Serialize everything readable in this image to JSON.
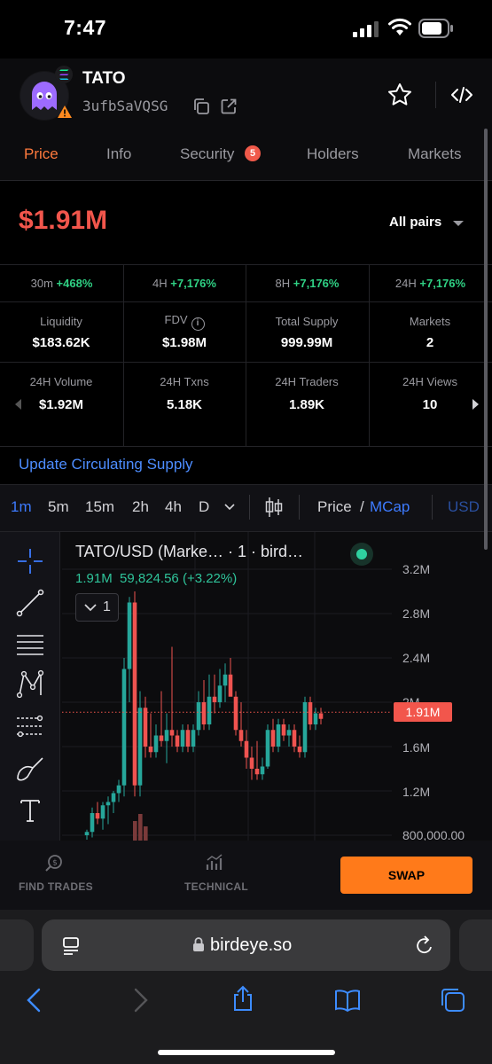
{
  "status_bar": {
    "time": "7:47"
  },
  "token": {
    "name": "TATO",
    "address": "3ufbSaVQSG"
  },
  "tabs": [
    {
      "label": "Price",
      "active": true
    },
    {
      "label": "Info",
      "active": false
    },
    {
      "label": "Security",
      "active": false,
      "badge": "5"
    },
    {
      "label": "Holders",
      "active": false
    },
    {
      "label": "Markets",
      "active": false
    }
  ],
  "price": {
    "market_cap": "$1.91M",
    "pair_selector": "All pairs"
  },
  "changes": [
    {
      "period": "30m",
      "value": "+468%"
    },
    {
      "period": "4H",
      "value": "+7,176%"
    },
    {
      "period": "8H",
      "value": "+7,176%"
    },
    {
      "period": "24H",
      "value": "+7,176%"
    }
  ],
  "stats_row1": [
    {
      "label": "Liquidity",
      "value": "$183.62K"
    },
    {
      "label": "FDV",
      "value": "$1.98M",
      "info": "i"
    },
    {
      "label": "Total Supply",
      "value": "999.99M"
    },
    {
      "label": "Markets",
      "value": "2"
    }
  ],
  "stats_row2": [
    {
      "label": "24H Volume",
      "value": "$1.92M"
    },
    {
      "label": "24H Txns",
      "value": "5.18K"
    },
    {
      "label": "24H Traders",
      "value": "1.89K"
    },
    {
      "label": "24H Views",
      "value": "10"
    }
  ],
  "update_link": "Update Circulating Supply",
  "intervals": [
    "1m",
    "5m",
    "15m",
    "2h",
    "4h",
    "D"
  ],
  "active_interval": "1m",
  "view_toggle": {
    "price": "Price",
    "separator": "/",
    "mcap": "MCap",
    "currency": "USD"
  },
  "chart": {
    "title": "TATO/USD (Marke…  · 1 · bird…",
    "ohlc_last": "1.91M",
    "ohlc_change": "59,824.56 (+3.22%)",
    "collapse_label": "1",
    "last_price_label": "1.91M",
    "y_ticks": [
      "3.2M",
      "2.8M",
      "2.4M",
      "2M",
      "1.6M",
      "1.2M",
      "800,000.00"
    ],
    "colors": {
      "up": "#26a69a",
      "down": "#ef5350",
      "bg": "#0c0c0e"
    }
  },
  "chart_data": {
    "type": "candlestick",
    "title": "TATO/USD (Marke…  · 1 · bird…",
    "ylim": [
      800000,
      3400000
    ],
    "y_ticks": [
      3200000,
      2800000,
      2400000,
      2000000,
      1600000,
      1200000,
      800000
    ],
    "last_value": 1910000,
    "candles": [
      {
        "o": 800000,
        "h": 850000,
        "l": 760000,
        "c": 830000
      },
      {
        "o": 830000,
        "h": 1050000,
        "l": 780000,
        "c": 1000000
      },
      {
        "o": 1000000,
        "h": 1100000,
        "l": 900000,
        "c": 950000
      },
      {
        "o": 950000,
        "h": 1100000,
        "l": 850000,
        "c": 1070000
      },
      {
        "o": 1070000,
        "h": 1150000,
        "l": 900000,
        "c": 1100000
      },
      {
        "o": 1100000,
        "h": 1200000,
        "l": 1000000,
        "c": 1180000
      },
      {
        "o": 1180000,
        "h": 1300000,
        "l": 1100000,
        "c": 1250000
      },
      {
        "o": 1250000,
        "h": 2400000,
        "l": 1150000,
        "c": 2300000
      },
      {
        "o": 2300000,
        "h": 2950000,
        "l": 2000000,
        "c": 2900000
      },
      {
        "o": 2900000,
        "h": 3000000,
        "l": 1150000,
        "c": 1250000
      },
      {
        "o": 1250000,
        "h": 2100000,
        "l": 1150000,
        "c": 1950000
      },
      {
        "o": 1950000,
        "h": 2050000,
        "l": 1500000,
        "c": 1600000
      },
      {
        "o": 1600000,
        "h": 1900000,
        "l": 1500000,
        "c": 1550000
      },
      {
        "o": 1550000,
        "h": 1800000,
        "l": 1500000,
        "c": 1700000
      },
      {
        "o": 1700000,
        "h": 2100000,
        "l": 1600000,
        "c": 1650000
      },
      {
        "o": 1650000,
        "h": 1900000,
        "l": 1450000,
        "c": 1750000
      },
      {
        "o": 1750000,
        "h": 2500000,
        "l": 1600000,
        "c": 1700000
      },
      {
        "o": 1700000,
        "h": 1750000,
        "l": 1550000,
        "c": 1600000
      },
      {
        "o": 1600000,
        "h": 1800000,
        "l": 1550000,
        "c": 1750000
      },
      {
        "o": 1750000,
        "h": 1800000,
        "l": 1550000,
        "c": 1600000
      },
      {
        "o": 1600000,
        "h": 1800000,
        "l": 1550000,
        "c": 1750000
      },
      {
        "o": 1750000,
        "h": 2100000,
        "l": 1700000,
        "c": 2000000
      },
      {
        "o": 2000000,
        "h": 2200000,
        "l": 1750000,
        "c": 1800000
      },
      {
        "o": 1800000,
        "h": 2250000,
        "l": 1750000,
        "c": 2050000
      },
      {
        "o": 2050000,
        "h": 2250000,
        "l": 1900000,
        "c": 2000000
      },
      {
        "o": 2000000,
        "h": 2300000,
        "l": 1950000,
        "c": 2150000
      },
      {
        "o": 2150000,
        "h": 2350000,
        "l": 2000000,
        "c": 2250000
      },
      {
        "o": 2250000,
        "h": 2400000,
        "l": 2100000,
        "c": 2050000
      },
      {
        "o": 2050000,
        "h": 2100000,
        "l": 1700000,
        "c": 1750000
      },
      {
        "o": 1750000,
        "h": 2000000,
        "l": 1600000,
        "c": 1650000
      },
      {
        "o": 1650000,
        "h": 1750000,
        "l": 1400000,
        "c": 1500000
      },
      {
        "o": 1500000,
        "h": 1600000,
        "l": 1300000,
        "c": 1400000
      },
      {
        "o": 1400000,
        "h": 1650000,
        "l": 1300000,
        "c": 1350000
      },
      {
        "o": 1350000,
        "h": 1500000,
        "l": 1300000,
        "c": 1420000
      },
      {
        "o": 1420000,
        "h": 1800000,
        "l": 1400000,
        "c": 1750000
      },
      {
        "o": 1750000,
        "h": 1850000,
        "l": 1550000,
        "c": 1600000
      },
      {
        "o": 1600000,
        "h": 1850000,
        "l": 1550000,
        "c": 1800000
      },
      {
        "o": 1800000,
        "h": 1850000,
        "l": 1650000,
        "c": 1700000
      },
      {
        "o": 1700000,
        "h": 1800000,
        "l": 1600000,
        "c": 1750000
      },
      {
        "o": 1750000,
        "h": 1800000,
        "l": 1550000,
        "c": 1600000
      },
      {
        "o": 1600000,
        "h": 1700000,
        "l": 1500000,
        "c": 1550000
      },
      {
        "o": 1550000,
        "h": 2050000,
        "l": 1500000,
        "c": 2000000
      },
      {
        "o": 2000000,
        "h": 2050000,
        "l": 1750000,
        "c": 1800000
      },
      {
        "o": 1800000,
        "h": 1950000,
        "l": 1750000,
        "c": 1900000
      },
      {
        "o": 1900000,
        "h": 1950000,
        "l": 1800000,
        "c": 1850000
      }
    ],
    "volume_visible": true
  }
}
